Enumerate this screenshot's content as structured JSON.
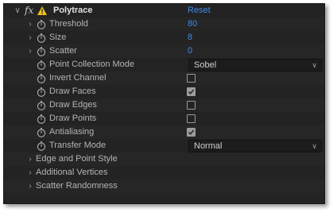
{
  "effect": {
    "name": "Polytrace",
    "reset_label": "Reset",
    "fx_label": "fx"
  },
  "rows": [
    {
      "label": "Threshold",
      "value": "80"
    },
    {
      "label": "Size",
      "value": "8"
    },
    {
      "label": "Scatter",
      "value": "0"
    },
    {
      "label": "Point Collection Mode",
      "value": "Sobel"
    },
    {
      "label": "Invert Channel",
      "checked": false
    },
    {
      "label": "Draw Faces",
      "checked": true
    },
    {
      "label": "Draw Edges",
      "checked": false
    },
    {
      "label": "Draw Points",
      "checked": false
    },
    {
      "label": "Antialiasing",
      "checked": true
    },
    {
      "label": "Transfer Mode",
      "value": "Normal"
    }
  ],
  "groups": [
    {
      "label": "Edge and Point Style"
    },
    {
      "label": "Additional Vertices"
    },
    {
      "label": "Scatter Randomness"
    }
  ],
  "icons": {
    "expand": "chevron-right-icon",
    "collapse": "chevron-down-icon",
    "stopwatch": "stopwatch-icon",
    "warning": "warning-icon",
    "dropdown": "chevron-down-icon"
  },
  "colors": {
    "panel_bg": "#232323",
    "value_blue": "#3d8ae8",
    "warning_yellow": "#f2c21b"
  }
}
